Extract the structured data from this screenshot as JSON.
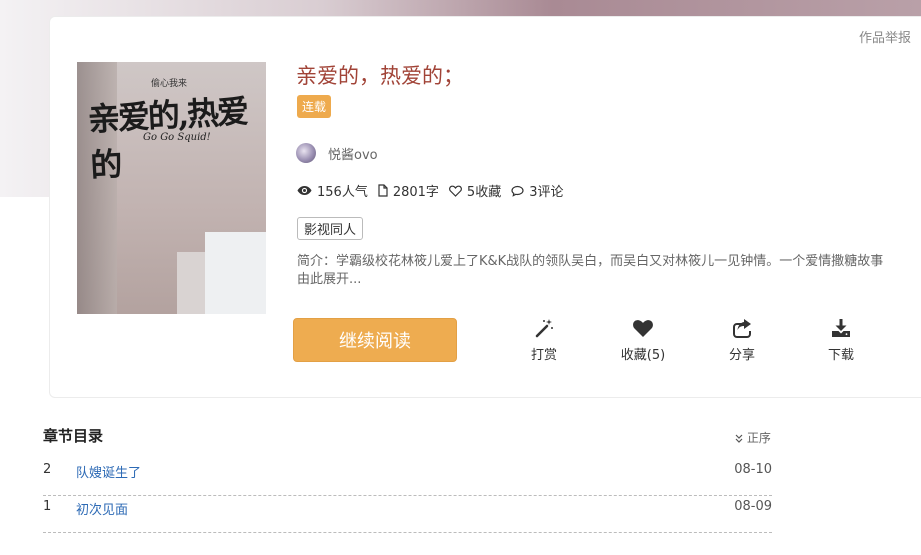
{
  "header": {
    "report_link": "作品举报"
  },
  "book": {
    "title": "亲爱的，热爱的；",
    "status_badge": "连载",
    "author": "悦酱ovo",
    "stats": {
      "popularity": "156人气",
      "words": "2801字",
      "favorites": "5收藏",
      "comments": "3评论"
    },
    "tag": "影视同人",
    "summary": "简介：学霸级校花林筱儿爱上了K&K战队的领队吴白，而吴白又对林筱儿一见钟情。一个爱情撒糖故事由此展开..."
  },
  "cover": {
    "top_text": "偷心我来",
    "title_text": "亲爱的,热爱的",
    "subtitle_text": "Go Go Squid!"
  },
  "actions": {
    "continue_reading": "继续阅读",
    "reward": "打赏",
    "favorite": "收藏(5)",
    "share": "分享",
    "download": "下载"
  },
  "toc": {
    "title": "章节目录",
    "sort_label": "正序",
    "chapters": [
      {
        "no": "2",
        "name": "队嫂诞生了",
        "date": "08-10"
      },
      {
        "no": "1",
        "name": "初次见面",
        "date": "08-09"
      }
    ]
  },
  "colors": {
    "accent": "#eeac50",
    "title": "#a14337",
    "link": "#2d6ab5"
  },
  "icons": [
    "eye-icon",
    "document-icon",
    "heart-outline-icon",
    "comment-icon",
    "magic-wand-icon",
    "heart-icon",
    "share-icon",
    "download-icon",
    "chevron-down-icon"
  ]
}
